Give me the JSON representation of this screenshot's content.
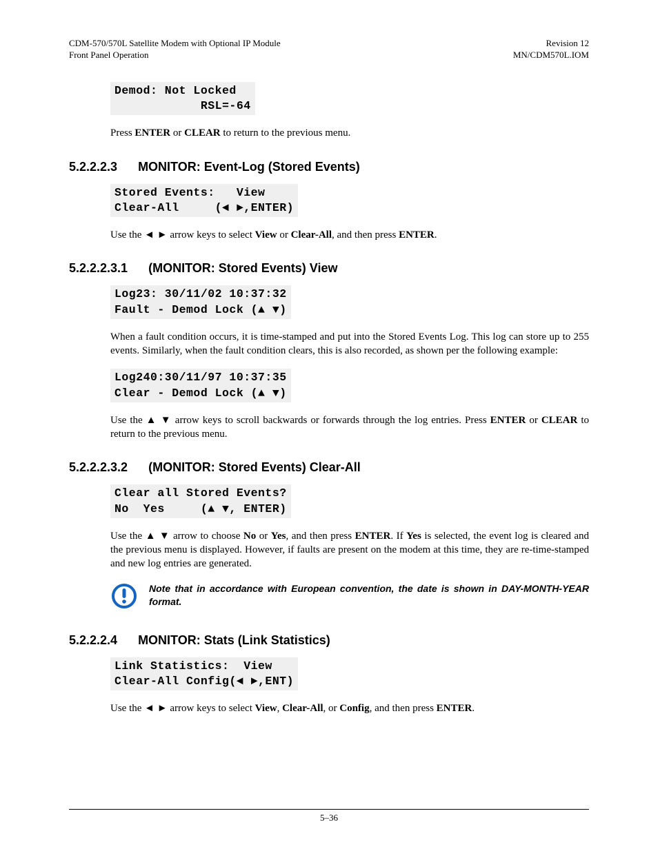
{
  "header": {
    "left1": "CDM-570/570L Satellite Modem with Optional IP Module",
    "left2": "Front Panel Operation",
    "right1": "Revision 12",
    "right2": "MN/CDM570L.IOM"
  },
  "lcd1_l1": "Demod: Not Locked",
  "lcd1_l2": "            RSL=-64",
  "p1_a": "Press ",
  "p1_b": "ENTER",
  "p1_c": " or ",
  "p1_d": "CLEAR",
  "p1_e": " to return to the previous menu.",
  "h1_num": "5.2.2.2.3",
  "h1_txt": "MONITOR: Event-Log (Stored Events)",
  "lcd2_l1": "Stored Events:   View",
  "lcd2_l2": "Clear-All     (◄ ►,ENTER)",
  "p2_a": "Use the ◄ ► arrow keys to select ",
  "p2_b": "View",
  "p2_c": " or ",
  "p2_d": "Clear-All",
  "p2_e": ", and then press ",
  "p2_f": "ENTER",
  "p2_g": ".",
  "h2_num": "5.2.2.2.3.1",
  "h2_txt": "(MONITOR: Stored Events) View",
  "lcd3_l1": "Log23: 30/11/02 10:37:32",
  "lcd3_l2": "Fault - Demod Lock (▲ ▼)",
  "p3": "When a fault condition occurs, it is time-stamped and put into the Stored Events Log. This log can store up to 255 events. Similarly, when the fault condition clears, this is also recorded, as shown per the following example:",
  "lcd4_l1": "Log240:30/11/97 10:37:35",
  "lcd4_l2": "Clear - Demod Lock (▲ ▼)",
  "p4_a": "Use the ▲ ▼ arrow keys to scroll backwards or forwards through the log entries. Press ",
  "p4_b": "ENTER",
  "p4_c": " or ",
  "p4_d": "CLEAR",
  "p4_e": " to return to the previous menu.",
  "h3_num": "5.2.2.2.3.2",
  "h3_txt": "(MONITOR: Stored Events) Clear-All",
  "lcd5_l1": "Clear all Stored Events?",
  "lcd5_l2": "No  Yes     (▲ ▼, ENTER)",
  "p5_a": "Use the ▲ ▼ arrow to choose ",
  "p5_b": "No",
  "p5_c": " or ",
  "p5_d": "Yes",
  "p5_e": ", and then press ",
  "p5_f": "ENTER",
  "p5_g": ". If ",
  "p5_h": "Yes",
  "p5_i": " is selected, the event log is cleared and the previous menu is displayed. However, if faults are present on the modem at this time, they are re-time-stamped and new log entries are generated.",
  "note": "Note that in accordance with European convention, the date is shown in DAY-MONTH-YEAR format.",
  "h4_num": "5.2.2.2.4",
  "h4_txt": "MONITOR: Stats (Link Statistics)",
  "lcd6_l1": "Link Statistics:  View",
  "lcd6_l2": "Clear-All Config(◄ ►,ENT)",
  "p6_a": "Use the ◄ ► arrow keys to select ",
  "p6_b": "View",
  "p6_c": ", ",
  "p6_d": "Clear-All",
  "p6_e": ", or ",
  "p6_f": "Config",
  "p6_g": ", and then press ",
  "p6_h": "ENTER",
  "p6_i": ".",
  "footer": "5–36"
}
